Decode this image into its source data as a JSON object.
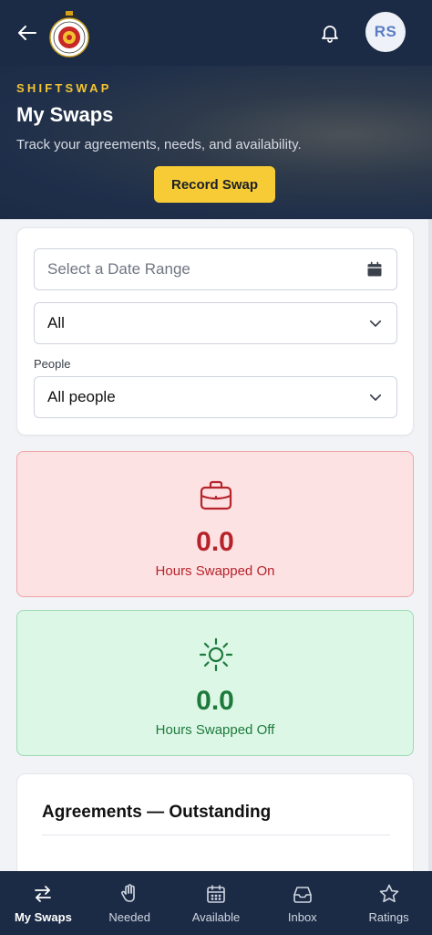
{
  "header": {
    "avatar_initials": "RS"
  },
  "hero": {
    "brand": "SHIFTSWAP",
    "title": "My Swaps",
    "subtitle": "Track your agreements, needs, and availability.",
    "record_button": "Record Swap"
  },
  "filters": {
    "date_range_placeholder": "Select a Date Range",
    "type_value": "All",
    "people_label": "People",
    "people_value": "All people"
  },
  "stats": {
    "on": {
      "value": "0.0",
      "label": "Hours Swapped On",
      "color": "#b6232b"
    },
    "off": {
      "value": "0.0",
      "label": "Hours Swapped Off",
      "color": "#1e7a3c"
    }
  },
  "agreements": {
    "title": "Agreements — Outstanding"
  },
  "nav": {
    "items": [
      {
        "label": "My Swaps",
        "icon": "swap-arrows-icon",
        "active": true
      },
      {
        "label": "Needed",
        "icon": "hand-icon",
        "active": false
      },
      {
        "label": "Available",
        "icon": "calendar-icon",
        "active": false
      },
      {
        "label": "Inbox",
        "icon": "inbox-icon",
        "active": false
      },
      {
        "label": "Ratings",
        "icon": "star-icon",
        "active": false
      }
    ]
  },
  "colors": {
    "header_bg": "#1c2b45",
    "accent": "#f6cb35",
    "brand": "#f4c531"
  }
}
